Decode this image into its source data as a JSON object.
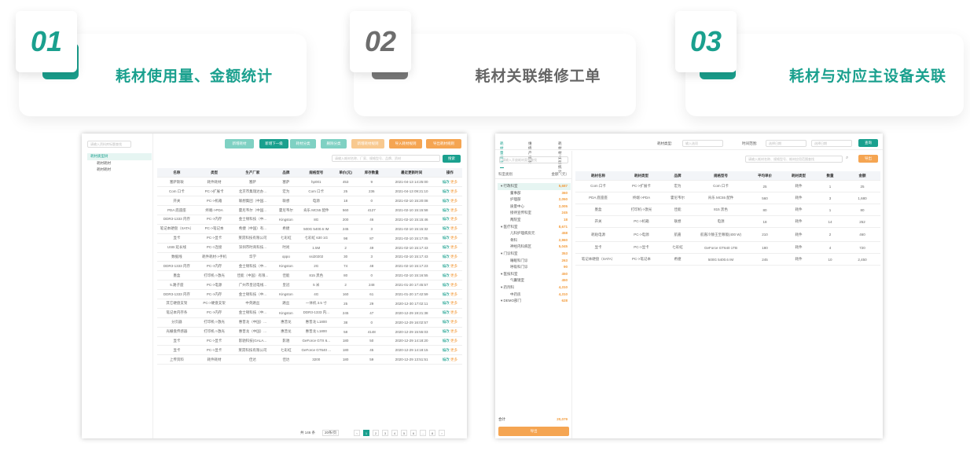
{
  "features": [
    {
      "num": "01",
      "title": "耗材使用量、金额统计",
      "color": "#1aa08e",
      "numColor": "#1aa08e"
    },
    {
      "num": "02",
      "title": "耗材关联维修工单",
      "color": "#666666",
      "numColor": "#6d6d6d"
    },
    {
      "num": "03",
      "title": "耗材与对应主设备关联",
      "color": "#1aa08e",
      "numColor": "#1aa08e"
    }
  ],
  "left": {
    "tree_search": "请输入资料库标题查找",
    "tree": [
      "耗材类型树",
      "耗材耗材",
      "耗材耗材"
    ],
    "buttons": [
      {
        "label": "新增耗材",
        "color": "#7fd1c3"
      },
      {
        "label": "新增下一级",
        "color": "#1aa08e"
      },
      {
        "label": "耗材分类",
        "color": "#7fd1c3"
      },
      {
        "label": "删除分类",
        "color": "#7fd1c3"
      },
      {
        "label": "新增耗材规则",
        "color": "#f8c98f"
      },
      {
        "label": "导入耗材规则",
        "color": "#f5a552"
      },
      {
        "label": "导出耗材规则",
        "color": "#f5a552"
      }
    ],
    "search_placeholder": "请输入耗材名称、厂家、规格型号、品牌、资材",
    "search_button": "搜索",
    "headers": [
      "名称",
      "类型",
      "生产厂家",
      "品牌",
      "规格型号",
      "单价(元)",
      "库存数量",
      "最近更新时间",
      "操作"
    ],
    "rows": [
      [
        "塞萨斯耿",
        "耗件耗材",
        "塞萨",
        "塞萨",
        "hp001",
        "453",
        "9",
        "2021-04-13 14:25:00"
      ],
      [
        "Com 口卡",
        "PC->扩展卡",
        "北京市集瑞达办...",
        "宏为",
        "Com 口卡",
        "25",
        "236",
        "2021-04-13 09:21:10"
      ],
      [
        "开关",
        "PC->机箱",
        "联想集团（中国...",
        "联想",
        "电源",
        "18",
        "0",
        "2021-02-10 15:20:08"
      ],
      [
        "PDA 底座座",
        "终端->PDA",
        "霍尼韦尔（中国...",
        "霍尼韦尔",
        "肯乐 MC55 配件",
        "560",
        "4127",
        "2021-02-10 15:15:58"
      ],
      [
        "DDR3-1333 内存",
        "PC->内存",
        "金士顿科技（中...",
        "Kingston",
        "8G",
        "200",
        "46",
        "2021-02-10 15:15:46"
      ],
      [
        "笔记本硬盘（SATA）",
        "PC->笔记本",
        "希捷（中国）有...",
        "希捷",
        "500G 5400.6 IM",
        "245",
        "3",
        "2021-02-10 15:15:32"
      ],
      [
        "显卡",
        "PC->显卡",
        "莱昂科技有限公司",
        "七彩虹",
        "七彩虹 630 1G",
        "98",
        "87",
        "2021-02-10 15:17:05"
      ],
      [
        "USB 延长线",
        "PC->连接",
        "深圳市时商科技...",
        "时尚",
        "1.5M",
        "2",
        "49",
        "2021-02-10 15:17:43"
      ],
      [
        "数据线",
        "耗件耗材->手机",
        "华学",
        "oppo",
        "ssi20202",
        "30",
        "3",
        "2021-02-10 15:17:43"
      ],
      [
        "DDR3-1333 内存",
        "PC->内存",
        "金士顿科技（中...",
        "Kingston",
        "2G",
        "74",
        "48",
        "2021-02-10 15:17:23"
      ],
      [
        "墨盒",
        "打印机->激光",
        "佳能（中国）有限...",
        "佳能",
        "815 黑色",
        "80",
        "0",
        "2021-02-10 15:16:55"
      ],
      [
        "5.路子座",
        "PC->电源",
        "广州市皇冠电线...",
        "皇冠",
        "5 米",
        "2",
        "248",
        "2021-01-20 17:45:57"
      ],
      [
        "DDR3-1333 内存",
        "PC->内存",
        "金士顿科技（中...",
        "Kingston",
        "4G",
        "160",
        "61",
        "2021-01-20 17:42:59"
      ],
      [
        "其它硬盘支架",
        "PC->硬盘支架",
        "中英路丝",
        "路丝",
        "一体机 3.5 寸",
        "25",
        "29",
        "2020-12-30 17:02:11"
      ],
      [
        "笔记本内存条",
        "PC->内存",
        "金士顿科技（中...",
        "Kingston",
        "DDR3-1333 内...",
        "245",
        "47",
        "2020-12-29 19:21:38"
      ],
      [
        "分页器",
        "打印机->激光",
        "惠普龙（中国）...",
        "惠普龙",
        "惠普龙 L1800",
        "38",
        "0",
        "2020-12-29 16:02:57"
      ],
      [
        "光栅盘传感器",
        "打印机->激光",
        "惠普龙（中国）...",
        "惠普龙",
        "惠普龙 L1800",
        "58",
        "4148",
        "2020-12-29 15:55:03"
      ],
      [
        "显卡",
        "PC->显卡",
        "影驰科技(GALA...",
        "影驰",
        "GeForce GTX 6...",
        "180",
        "50",
        "2020-12-29 14:18:20"
      ],
      [
        "显卡",
        "PC->显卡",
        "莱昂科技有限公司",
        "七彩虹",
        "GeForce GT640 ...",
        "180",
        "45",
        "2020-12-29 14:18:15"
      ],
      [
        "上传资料",
        "耗件耗材",
        "佳达",
        "佳达",
        "3200",
        "180",
        "59",
        "2020-12-29 13:51:51"
      ]
    ],
    "ops": [
      "编改",
      "更多"
    ],
    "pager_total": "共 146 条",
    "pager_size": "20条/页",
    "pages": [
      "‹",
      "1",
      "2",
      "3",
      "4",
      "5",
      "6",
      "...",
      "8",
      "›"
    ]
  },
  "right": {
    "tabs": [
      "耗材量统计",
      "维修产统计",
      "耗材材类型统计"
    ],
    "type_label": "耗材类型:",
    "type_placeholder": "输入选项",
    "time_label": "时间范围:",
    "date_start": "选择日期",
    "date_end": "选择日期",
    "query_button": "查询",
    "left_search": "请输入开放耗材类型查找",
    "left_header": [
      "科室类别",
      "金额（元）"
    ],
    "tree": [
      {
        "label": "行政科室",
        "value": "5,687",
        "indent": 0
      },
      {
        "label": "董事部",
        "value": "360",
        "indent": 1
      },
      {
        "label": "护理部",
        "value": "2,050",
        "indent": 1
      },
      {
        "label": "质量中心",
        "value": "2,005",
        "indent": 1
      },
      {
        "label": "接待宣传科室",
        "value": "245",
        "indent": 1
      },
      {
        "label": "两院室",
        "value": "18",
        "indent": 1
      },
      {
        "label": "医疗科室",
        "value": "8,671",
        "indent": 0
      },
      {
        "label": "儿科护理病房元",
        "value": "458",
        "indent": 1
      },
      {
        "label": "骨科",
        "value": "2,960",
        "indent": 1
      },
      {
        "label": "神经内科病区",
        "value": "5,045",
        "indent": 1
      },
      {
        "label": "门诊科室",
        "value": "353",
        "indent": 0
      },
      {
        "label": "睡眠科门诊",
        "value": "263",
        "indent": 1
      },
      {
        "label": "呼吸科门诊",
        "value": "90",
        "indent": 1
      },
      {
        "label": "医技科室",
        "value": "450",
        "indent": 0
      },
      {
        "label": "气囊镜室",
        "value": "450",
        "indent": 1
      },
      {
        "label": "药剂科",
        "value": "4,310",
        "indent": 0
      },
      {
        "label": "中药房",
        "value": "4,310",
        "indent": 1
      },
      {
        "label": "DEMO部门",
        "value": "628",
        "indent": 0
      }
    ],
    "total_label": "合计",
    "total_value": "20,079",
    "export_button": "导出",
    "search_placeholder": "请输入耗材名称、规格型号、耗材应用范围查找",
    "right_btn": "导出",
    "headers": [
      "耗材名称",
      "耗材类型",
      "品牌",
      "规格型号",
      "平均单价",
      "耗材类型",
      "数量",
      "金额"
    ],
    "rows": [
      [
        "Com 口卡",
        "PC->扩展卡",
        "宏为",
        "Com 口卡",
        "25",
        "耗件",
        "1",
        "25"
      ],
      [
        "PDA 底座座",
        "终端->PDA",
        "霍尼韦尔",
        "肯乐 MC55 配件",
        "560",
        "耗件",
        "3",
        "1,680"
      ],
      [
        "墨盒",
        "打印机->激光",
        "佳能",
        "815 黑色",
        "80",
        "耗件",
        "1",
        "80"
      ],
      [
        "开关",
        "PC->机箱",
        "联想",
        "电源",
        "18",
        "耗件",
        "14",
        "252"
      ],
      [
        "耗粘电源",
        "PC->电源",
        "航嘉",
        "航嘉冷静王至尊版(400 W)",
        "210",
        "耗件",
        "2",
        "460"
      ],
      [
        "显卡",
        "PC->显卡",
        "七彩虹",
        "GeForce GT640 1TB",
        "180",
        "耗件",
        "4",
        "720"
      ],
      [
        "笔记本硬盘（SATA）",
        "PC->笔记本",
        "希捷",
        "500G 5400.6 IM",
        "245",
        "耗件",
        "10",
        "2,450"
      ]
    ]
  }
}
